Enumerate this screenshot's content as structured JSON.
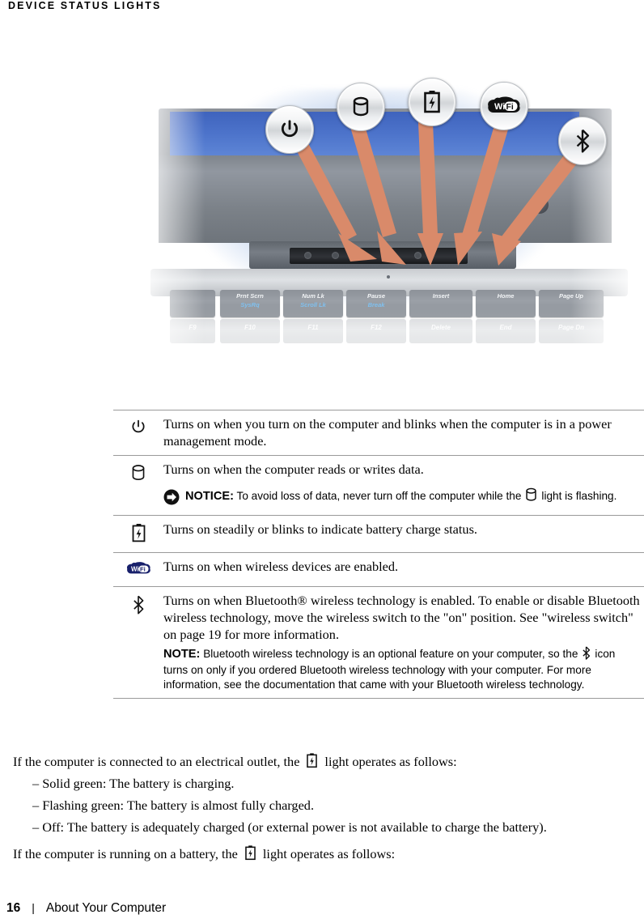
{
  "heading": "DEVICE STATUS LIGHTS",
  "figure": {
    "callouts": [
      {
        "icon": "power-icon",
        "name": "callout-power"
      },
      {
        "icon": "hard-drive-icon",
        "name": "callout-hard-drive"
      },
      {
        "icon": "battery-icon",
        "name": "callout-battery"
      },
      {
        "icon": "wifi-icon",
        "name": "callout-wifi",
        "label": "Wi Fi"
      },
      {
        "icon": "bluetooth-icon",
        "name": "callout-bluetooth"
      }
    ],
    "keyboard": {
      "top_row": [
        {
          "primary": "",
          "secondary": ""
        },
        {
          "primary": "Prnt Scrn",
          "secondary": "SysRq"
        },
        {
          "primary": "Num Lk",
          "secondary": "Scroll Lk"
        },
        {
          "primary": "Pause",
          "secondary": "Break"
        },
        {
          "primary": "Insert",
          "secondary": ""
        },
        {
          "primary": "Home",
          "secondary": ""
        },
        {
          "primary": "Page Up",
          "secondary": ""
        }
      ],
      "bottom_row": [
        "F9",
        "F10",
        "F11",
        "F12",
        "Delete",
        "End",
        "Page Dn"
      ]
    }
  },
  "table": {
    "rows": [
      {
        "icon": "power-icon",
        "text": "Turns on when you turn on the computer and blinks when the computer is in a power management mode."
      },
      {
        "icon": "hard-drive-icon",
        "text": "Turns on when the computer reads or writes data.",
        "notice": {
          "label": "NOTICE:",
          "text_before_icon": "To avoid loss of data, never turn off the computer while the",
          "inline_icon": "hard-drive-icon",
          "text_after_icon": "light is flashing."
        }
      },
      {
        "icon": "battery-icon",
        "text": "Turns on steadily or blinks to indicate battery charge status."
      },
      {
        "icon": "wifi-icon",
        "text": "Turns on when wireless devices are enabled."
      },
      {
        "icon": "bluetooth-icon",
        "text": "Turns on when Bluetooth® wireless technology is enabled. To enable or disable Bluetooth wireless technology, move the wireless switch to the \"on\" position. See \"wireless switch\" on page 19 for more information.",
        "note": {
          "label": "NOTE:",
          "text_before_icon": "Bluetooth wireless technology is an optional feature on your computer, so the",
          "inline_icon": "bluetooth-icon",
          "text_after_icon": "icon turns on only if you ordered Bluetooth wireless technology with your computer. For more information, see the documentation that came with your Bluetooth wireless technology."
        }
      }
    ]
  },
  "body": {
    "outlet_intro_before": "If the computer is connected to an electrical outlet, the",
    "outlet_intro_icon": "battery-icon",
    "outlet_intro_after": "light operates as follows:",
    "outlet_bullets": [
      "– Solid green: The battery is charging.",
      "– Flashing green: The battery is almost fully charged.",
      "– Off: The battery is adequately charged (or external power is not available to charge the battery)."
    ],
    "battery_intro_before": "If the computer is running on a battery, the",
    "battery_intro_icon": "battery-icon",
    "battery_intro_after": "light operates as follows:"
  },
  "footer": {
    "page_number": "16",
    "separator": "|",
    "title": "About Your Computer"
  },
  "colors": {
    "leader_line": "#d98a6a",
    "screen_blue": "#4a6fc4",
    "rule": "#9a9a9a",
    "text": "#000000"
  }
}
